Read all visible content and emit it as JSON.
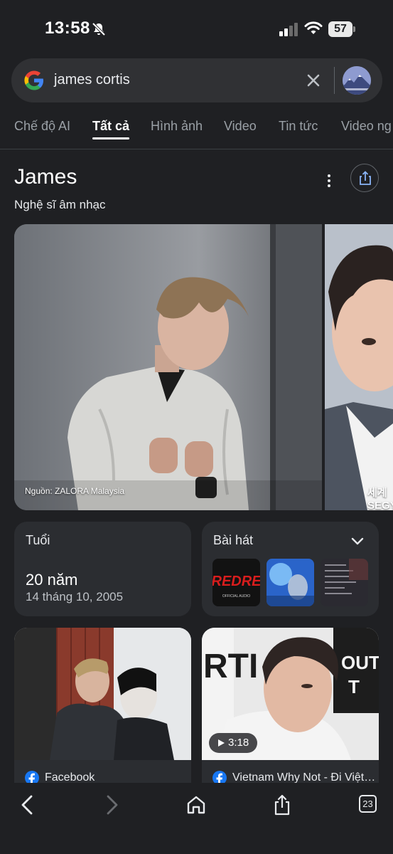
{
  "status_bar": {
    "time": "13:58",
    "battery": "57"
  },
  "search": {
    "query": "james cortis"
  },
  "tabs": [
    {
      "label": "Chế độ AI"
    },
    {
      "label": "Tất cả",
      "active": true
    },
    {
      "label": "Hình ảnh"
    },
    {
      "label": "Video"
    },
    {
      "label": "Tin tức"
    },
    {
      "label": "Video ng"
    }
  ],
  "entity": {
    "title": "James",
    "subtitle": "Nghệ sĩ âm nhạc"
  },
  "images": {
    "main_caption": "Nguồn: ZALORA Malaysia",
    "second_watermark": "세계\nSEGY"
  },
  "age_card": {
    "label": "Tuổi",
    "value": "20 năm",
    "birthdate": "14 tháng 10, 2005"
  },
  "songs_card": {
    "label": "Bài hát",
    "thumb_text": "REDRE",
    "thumb_subtext": "OFFICIAL AUDIO"
  },
  "results": [
    {
      "source": "Facebook"
    },
    {
      "source": "Vietnam Why Not - Đi Việt…",
      "duration": "3:18"
    }
  ],
  "bottom_bar": {
    "tab_count": "23"
  },
  "colors": {
    "background": "#1f2023",
    "surface": "#2b2d31",
    "search_bg": "#303134",
    "facebook_blue": "#1877f2"
  }
}
